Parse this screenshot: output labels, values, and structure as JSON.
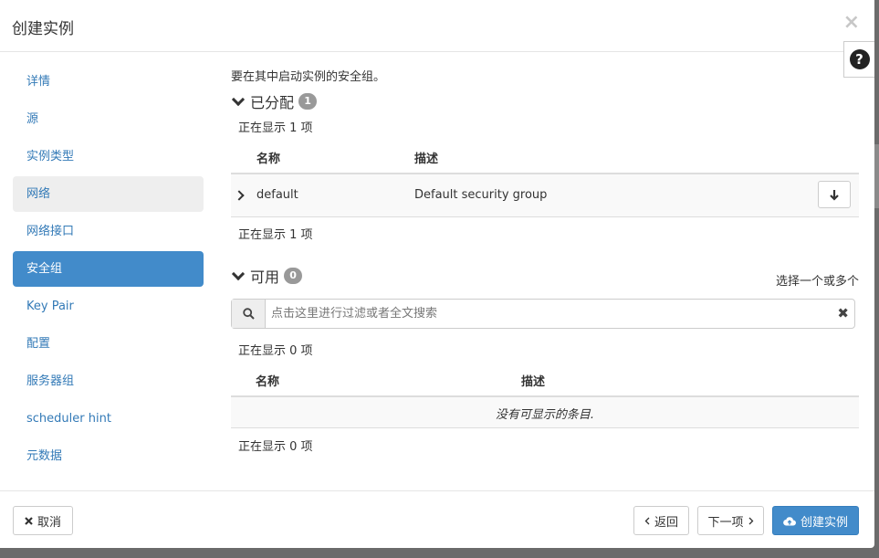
{
  "modal": {
    "title": "创建实例",
    "close_glyph": "×",
    "help_glyph": "?"
  },
  "sidebar": {
    "items": [
      {
        "label": "详情"
      },
      {
        "label": "源"
      },
      {
        "label": "实例类型"
      },
      {
        "label": "网络"
      },
      {
        "label": "网络接口"
      },
      {
        "label": "安全组"
      },
      {
        "label": "Key Pair"
      },
      {
        "label": "配置"
      },
      {
        "label": "服务器组"
      },
      {
        "label": "scheduler hint"
      },
      {
        "label": "元数据"
      }
    ],
    "active_index": 5
  },
  "main": {
    "intro": "要在其中启动实例的安全组。",
    "allocated": {
      "title": "已分配",
      "badge": "1",
      "count_top": "正在显示 1 项",
      "count_bottom": "正在显示 1 项",
      "columns": [
        "名称",
        "描述"
      ],
      "rows": [
        {
          "name": "default",
          "description": "Default security group"
        }
      ]
    },
    "available": {
      "title": "可用",
      "badge": "0",
      "select_hint": "选择一个或多个",
      "search_placeholder": "点击这里进行过滤或者全文搜索",
      "count_top": "正在显示 0 项",
      "count_bottom": "正在显示 0 项",
      "columns": [
        "名称",
        "描述"
      ],
      "empty_message": "没有可显示的条目."
    }
  },
  "footer": {
    "cancel_label": "取消",
    "back_label": "返回",
    "next_label": "下一项",
    "create_label": "创建实例"
  },
  "colors": {
    "accent": "#428bca",
    "link": "#337ab7",
    "badge": "#999999"
  }
}
